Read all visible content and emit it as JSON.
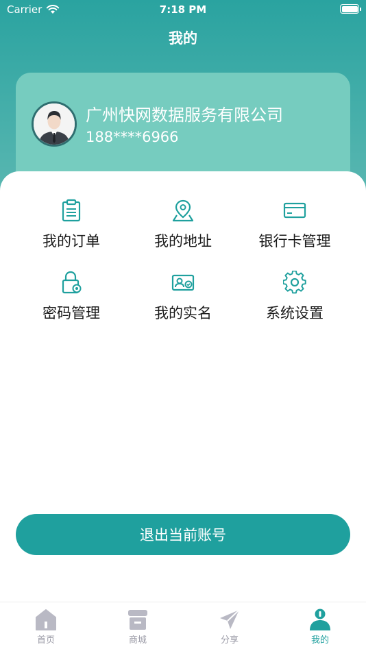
{
  "status_bar": {
    "carrier": "Carrier",
    "time": "7:18 PM"
  },
  "header": {
    "title": "我的"
  },
  "profile": {
    "company": "广州快网数据服务有限公司",
    "phone": "188****6966"
  },
  "menu": [
    {
      "label": "我的订单",
      "icon": "clipboard-icon"
    },
    {
      "label": "我的地址",
      "icon": "location-pin-icon"
    },
    {
      "label": "银行卡管理",
      "icon": "bank-card-icon"
    },
    {
      "label": "密码管理",
      "icon": "lock-gear-icon"
    },
    {
      "label": "我的实名",
      "icon": "id-card-icon"
    },
    {
      "label": "系统设置",
      "icon": "gear-icon"
    }
  ],
  "logout_label": "退出当前账号",
  "tabs": [
    {
      "label": "首页",
      "icon": "home-icon",
      "active": false
    },
    {
      "label": "商城",
      "icon": "store-icon",
      "active": false
    },
    {
      "label": "分享",
      "icon": "send-icon",
      "active": false
    },
    {
      "label": "我的",
      "icon": "person-icon",
      "active": true
    }
  ],
  "colors": {
    "accent": "#1fa09e",
    "header_top": "#2aa3a0",
    "card": "#76ccbf",
    "tab_inactive": "#9a9aa6"
  }
}
